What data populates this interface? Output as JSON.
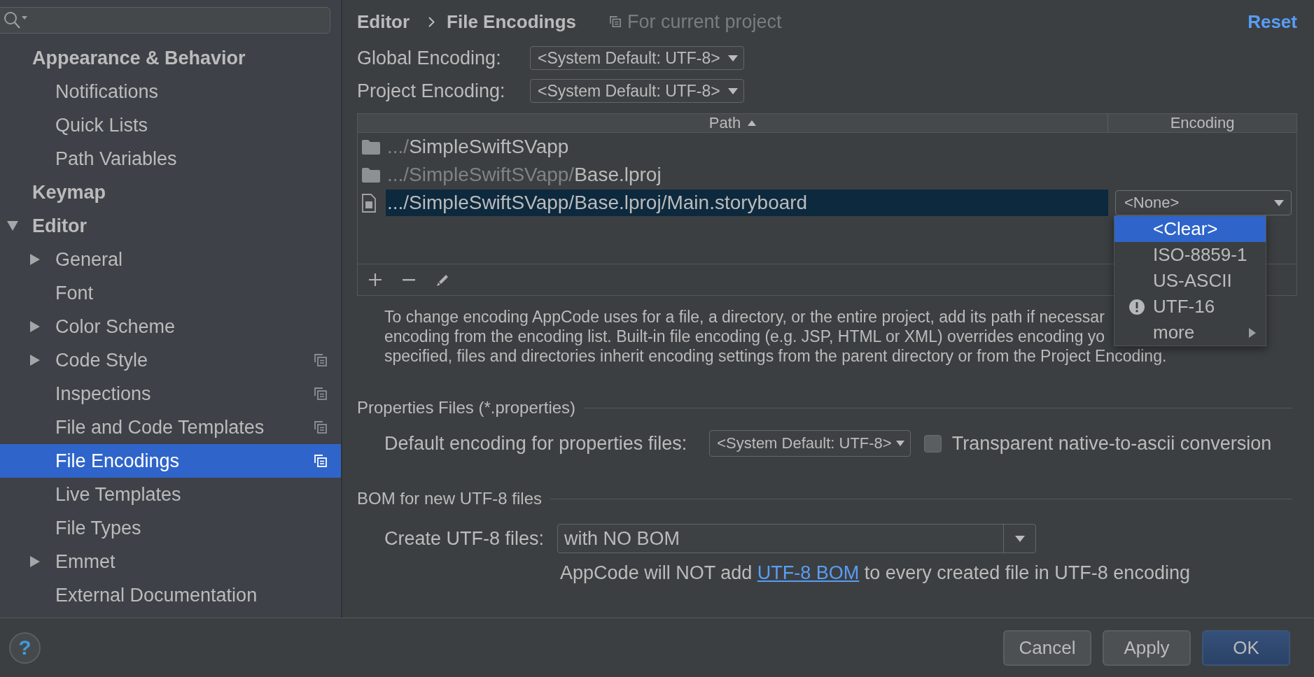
{
  "sidebar": {
    "items": [
      {
        "label": "Appearance & Behavior",
        "selected": false,
        "children": [
          {
            "label": "Notifications",
            "selected": false
          },
          {
            "label": "Quick Lists",
            "selected": false
          },
          {
            "label": "Path Variables",
            "selected": false
          }
        ]
      },
      {
        "label": "Keymap",
        "selected": false
      },
      {
        "label": "Editor",
        "selected": false,
        "expanded": true,
        "children": [
          {
            "label": "General",
            "selected": false,
            "expanded": false
          },
          {
            "label": "Font",
            "selected": false
          },
          {
            "label": "Color Scheme",
            "selected": false,
            "expanded": false
          },
          {
            "label": "Code Style",
            "selected": false,
            "expanded": false,
            "project_level": true
          },
          {
            "label": "Inspections",
            "selected": false,
            "project_level": true
          },
          {
            "label": "File and Code Templates",
            "selected": false,
            "project_level": true
          },
          {
            "label": "File Encodings",
            "selected": true,
            "project_level": true
          },
          {
            "label": "Live Templates",
            "selected": false
          },
          {
            "label": "File Types",
            "selected": false
          },
          {
            "label": "Emmet",
            "selected": false,
            "expanded": false
          },
          {
            "label": "External Documentation",
            "selected": false
          }
        ]
      }
    ]
  },
  "breadcrumb": [
    {
      "label": "Editor"
    },
    {
      "label": "File Encodings"
    }
  ],
  "scope_note": "For current project",
  "reset_link": "Reset",
  "encodings": [
    {
      "label": "Global Encoding:",
      "value": "<System Default: UTF-8>"
    },
    {
      "label": "Project Encoding:",
      "value": "<System Default: UTF-8>"
    }
  ],
  "table": {
    "columns": [
      {
        "label": "Path",
        "sorted": true
      },
      {
        "label": "Encoding",
        "sorted": false
      }
    ],
    "rows": [
      {
        "kind": "folder",
        "path": ".../SimpleSwiftSVapp",
        "dim_parent": true,
        "selected": false
      },
      {
        "kind": "folder",
        "path": ".../SimpleSwiftSVapp/Base.lproj",
        "dim_parent": true,
        "selected": false
      },
      {
        "kind": "file",
        "path": ".../SimpleSwiftSVapp/Base.lproj/Main.storyboard",
        "dim_parent": false,
        "selected": true,
        "encoding": "<None>"
      }
    ]
  },
  "encoding_popup": {
    "items": [
      {
        "label": "<Clear>",
        "kind": "option",
        "selected": true
      },
      {
        "label": "ISO-8859-1",
        "kind": "option",
        "selected": false
      },
      {
        "label": "US-ASCII",
        "kind": "option",
        "selected": false
      },
      {
        "label": "UTF-16",
        "kind": "warning",
        "selected": false
      },
      {
        "label": "more",
        "kind": "submenu",
        "selected": false
      }
    ]
  },
  "description_lines": [
    "To change encoding AppCode uses for a file, a directory, or the entire project, add its path if necessar",
    "encoding from the encoding list. Built-in file encoding (e.g. JSP, HTML or XML) overrides encoding yo",
    "specified, files and directories inherit encoding settings from the parent directory or from the Project Encoding."
  ],
  "properties": {
    "title": "Properties Files (*.properties)",
    "label": "Default encoding for properties files:",
    "value": "<System Default: UTF-8>",
    "checkbox": {
      "label": "Transparent native-to-ascii conversion",
      "checked": false
    }
  },
  "bom": {
    "title": "BOM for new UTF-8 files",
    "label": "Create UTF-8 files:",
    "value": "with NO BOM",
    "note": {
      "before": "AppCode will NOT add",
      "link": "UTF-8 BOM",
      "after": "to every created file in UTF-8 encoding"
    }
  },
  "help_button": "?",
  "buttons": [
    {
      "label": "Cancel",
      "default": false
    },
    {
      "label": "Apply",
      "default": false
    },
    {
      "label": "OK",
      "default": true
    }
  ]
}
